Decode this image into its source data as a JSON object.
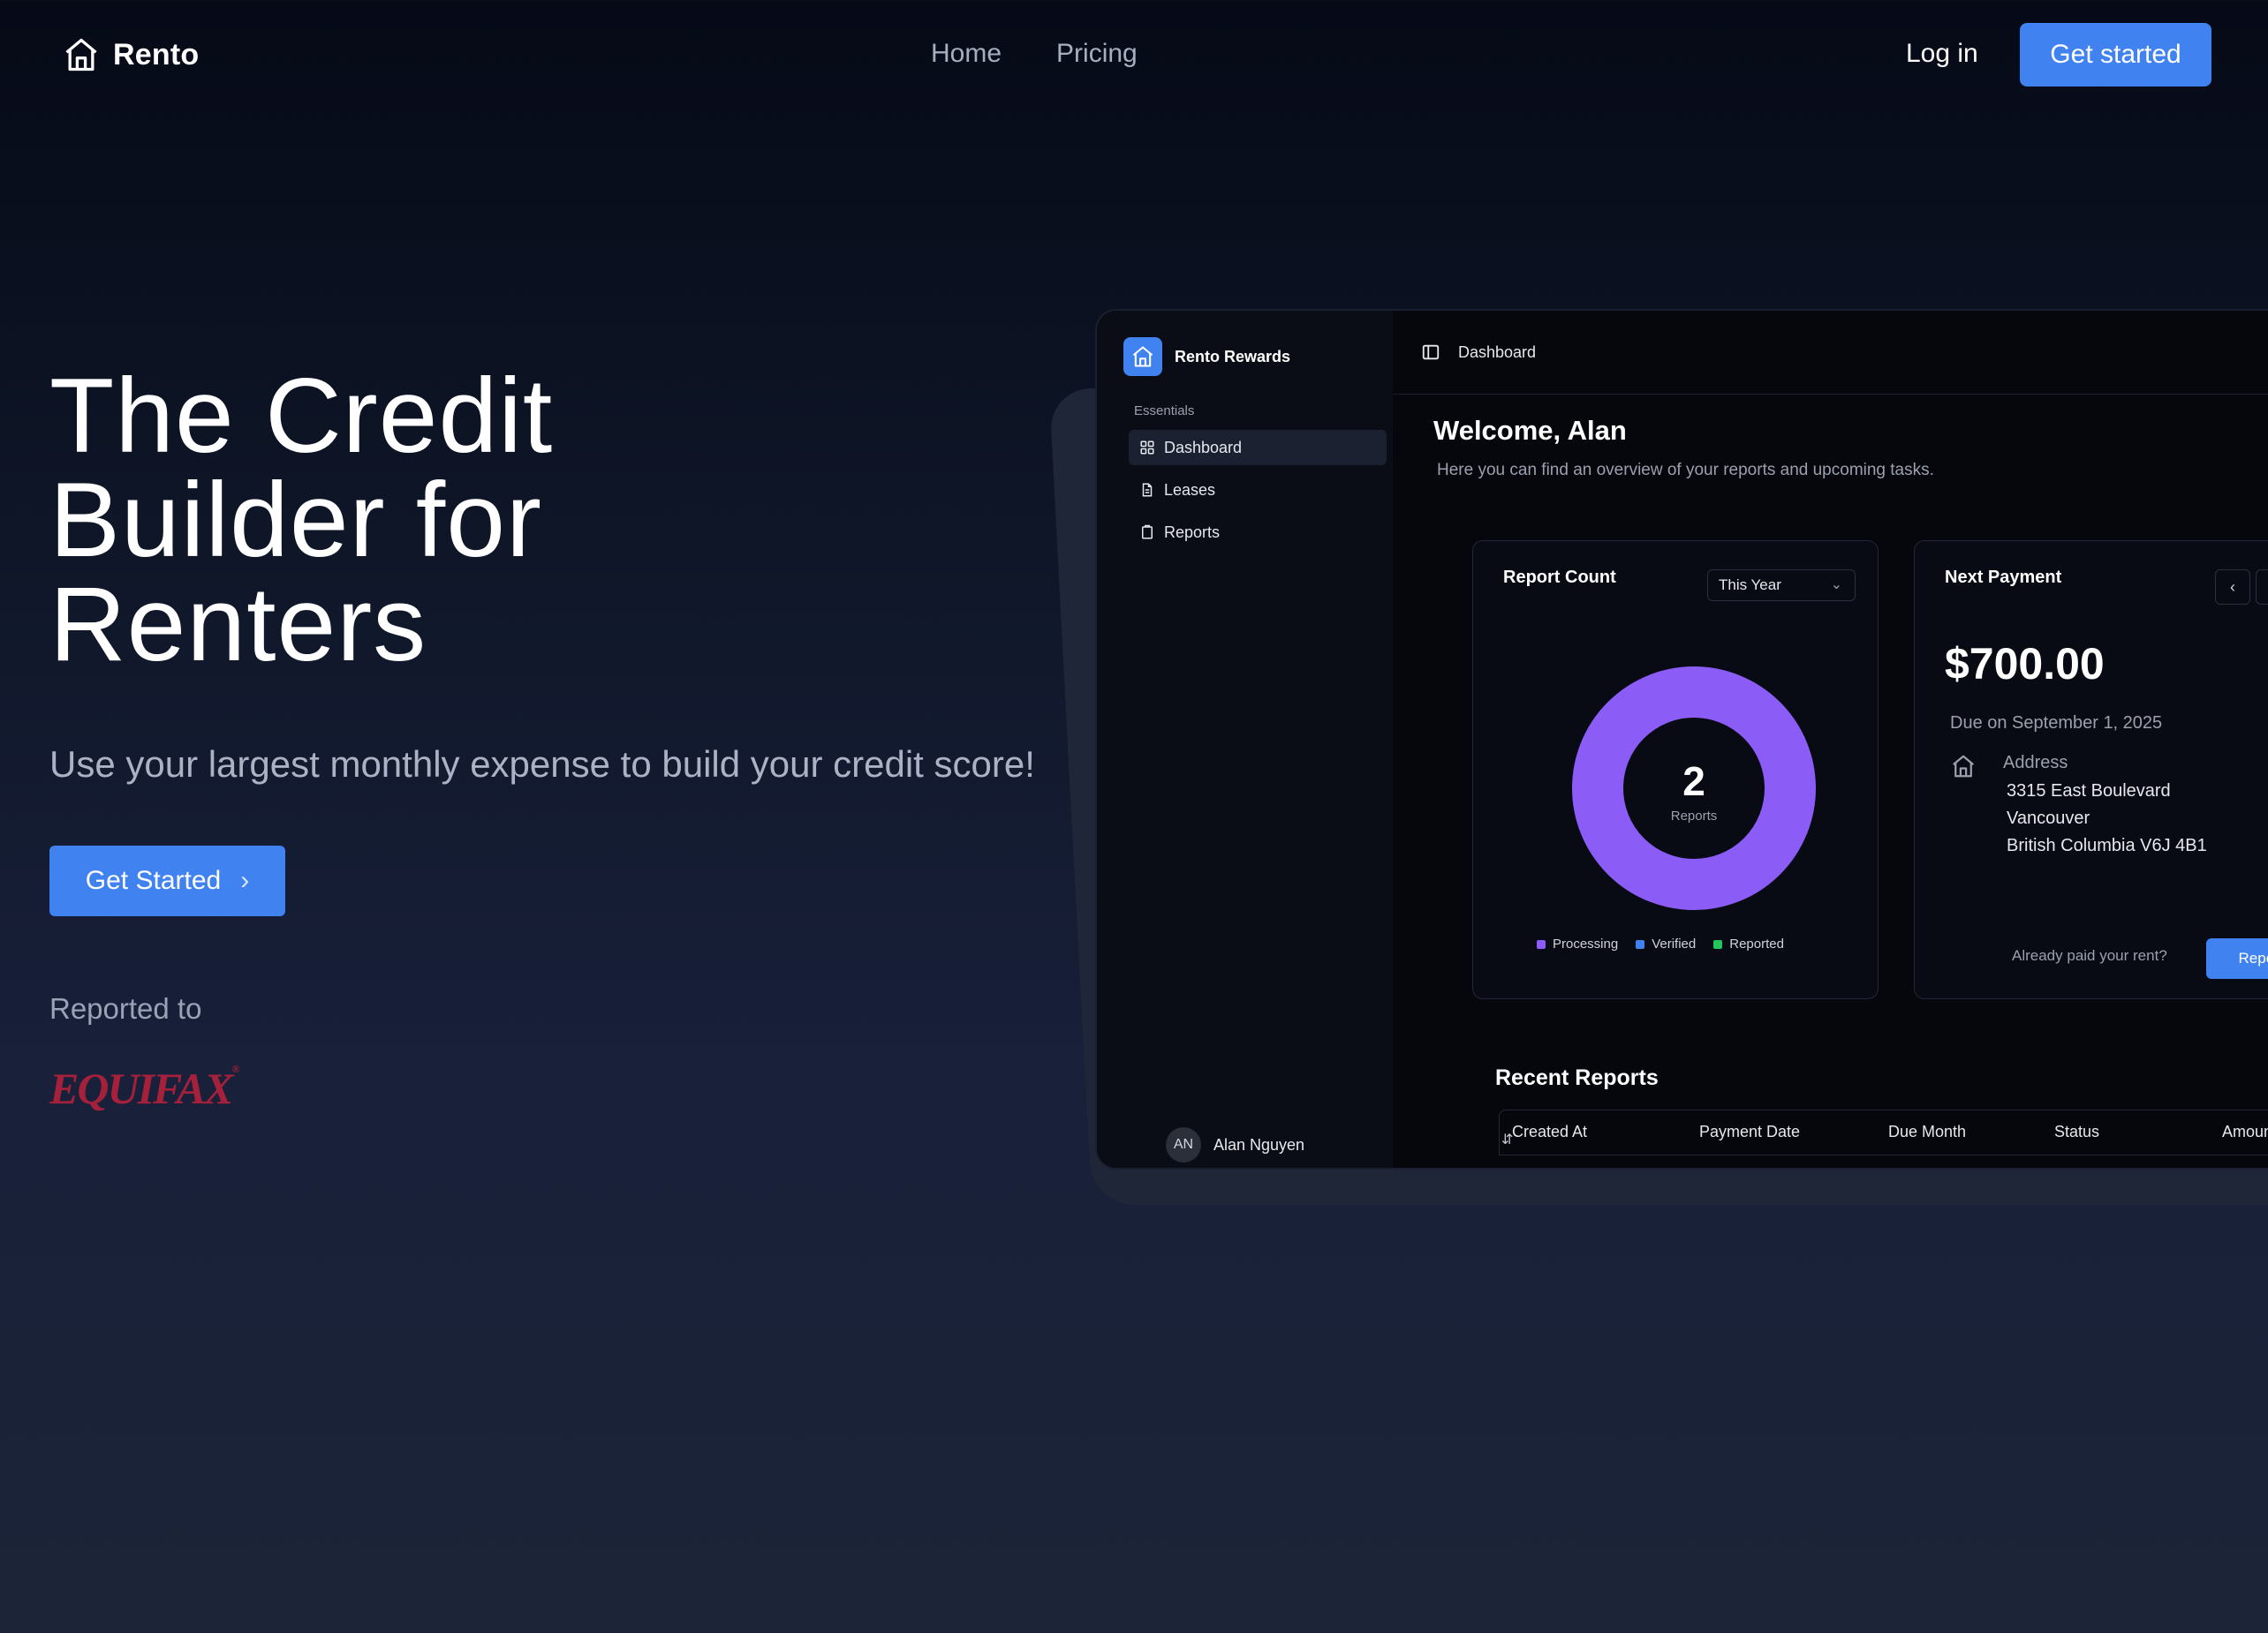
{
  "nav": {
    "brand": "Rento",
    "links": [
      "Home",
      "Pricing"
    ],
    "login": "Log in",
    "cta": "Get started"
  },
  "hero": {
    "title_lines": [
      "The Credit",
      "Builder for",
      "Renters"
    ],
    "subtitle": "Use your largest monthly expense to build your credit score!",
    "button": "Get Started",
    "reported_to": "Reported to",
    "partner_logo": "EQUIFAX"
  },
  "dashboard": {
    "brand": "Rento Rewards",
    "section": "Essentials",
    "nav_items": [
      "Dashboard",
      "Leases",
      "Reports"
    ],
    "breadcrumb": "Dashboard",
    "welcome": "Welcome, Alan",
    "welcome_sub": "Here you can find an overview of your reports and upcoming tasks.",
    "report_card": {
      "title": "Report Count",
      "filter": "This Year",
      "count": "2",
      "count_label": "Reports",
      "legend": [
        {
          "name": "Processing",
          "color": "#8b5cf6"
        },
        {
          "name": "Verified",
          "color": "#3f82f0"
        },
        {
          "name": "Reported",
          "color": "#22c55e"
        }
      ]
    },
    "payment_card": {
      "title": "Next Payment",
      "amount": "$700.00",
      "due": "Due on September 1, 2025",
      "address_label": "Address",
      "address_lines": [
        "3315 East Boulevard",
        "Vancouver",
        "British Columbia V6J 4B1"
      ],
      "question": "Already paid your rent?",
      "button": "Report now"
    },
    "recent_reports": {
      "title": "Recent Reports",
      "columns": [
        "Created At",
        "Payment Date",
        "Due Month",
        "Status",
        "Amount"
      ]
    },
    "user": {
      "initials": "AN",
      "name": "Alan Nguyen"
    }
  },
  "colors": {
    "accent": "#3f82f0",
    "donut": "#8b5cf6",
    "equifax": "#a5203a"
  }
}
